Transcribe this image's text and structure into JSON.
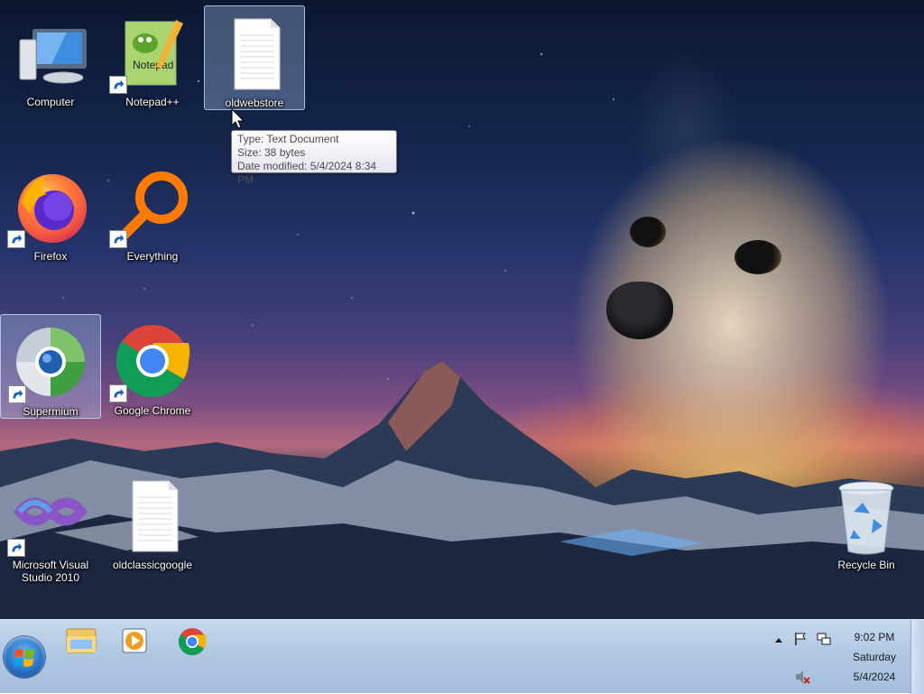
{
  "desktop": {
    "icons": [
      {
        "label": "Computer"
      },
      {
        "label": "Notepad++"
      },
      {
        "label": "oldwebstore"
      },
      {
        "label": "Firefox"
      },
      {
        "label": "Everything"
      },
      {
        "label": "Supermium"
      },
      {
        "label": "Google Chrome"
      },
      {
        "label": "Microsoft Visual Studio 2010"
      },
      {
        "label": "oldclassicgoogle"
      },
      {
        "label": "Recycle Bin"
      }
    ]
  },
  "tooltip": {
    "type": "Type: Text Document",
    "size": "Size: 38 bytes",
    "date": "Date modified: 5/4/2024 8:34 PM"
  },
  "taskbar": {
    "pinned": [
      "folder-icon",
      "media-player-icon",
      "chrome-icon"
    ],
    "clock": {
      "time": "9:02 PM",
      "day": "Saturday",
      "date": "5/4/2024"
    }
  },
  "colors": {
    "taskbar": "#b0c8e2",
    "selection": "#aac8f0",
    "chrome_red": "#db4437",
    "chrome_yellow": "#f4b400",
    "chrome_green": "#0f9d58",
    "chrome_blue": "#4285f4"
  }
}
